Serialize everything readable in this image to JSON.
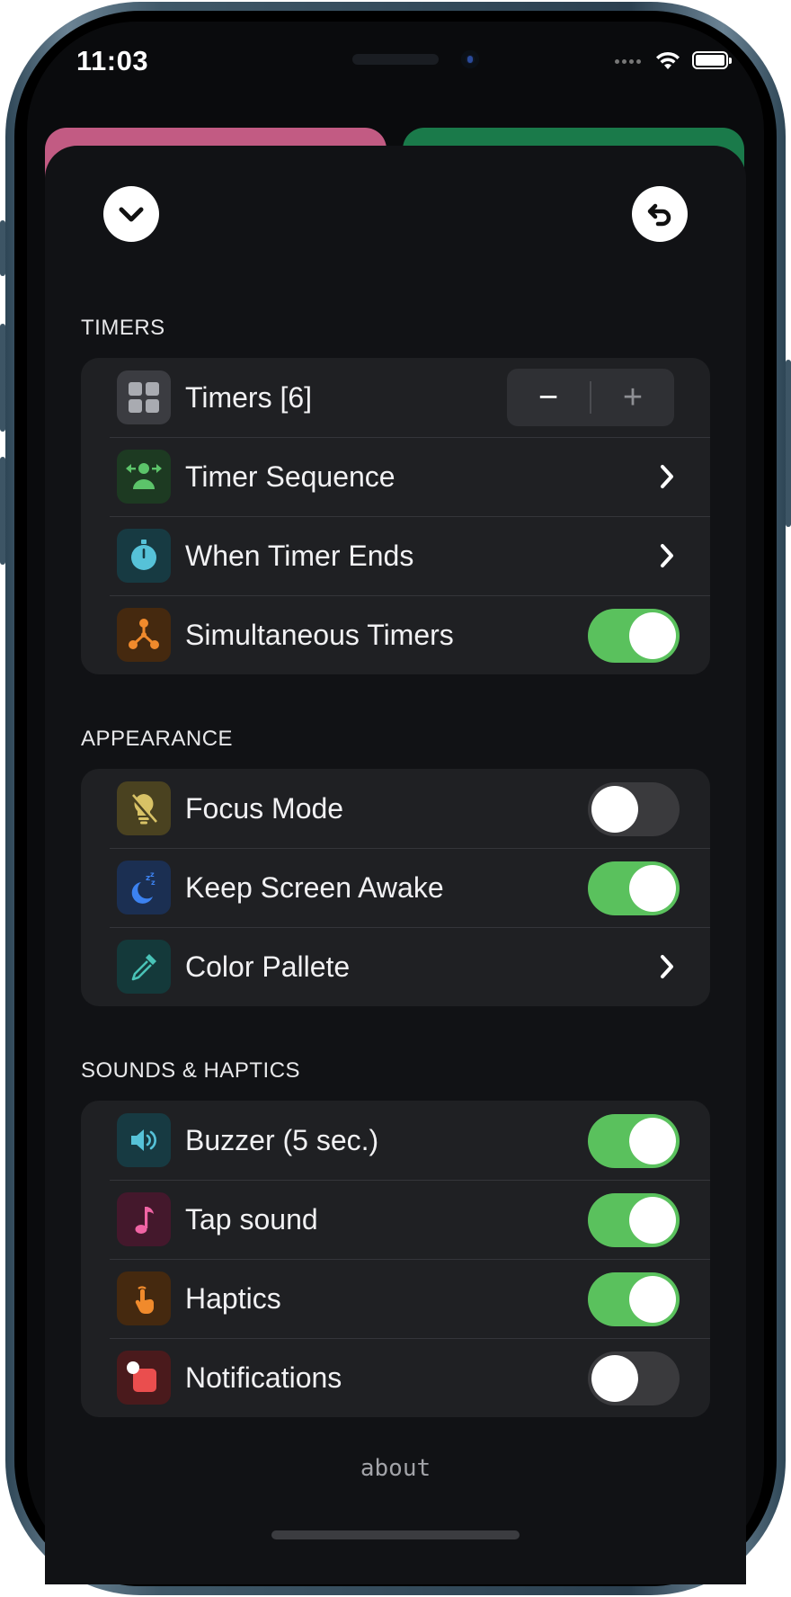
{
  "status_bar": {
    "time": "11:03"
  },
  "toolbar": {
    "collapse_icon": "chevron-down-icon",
    "reset_icon": "undo-icon"
  },
  "sections": {
    "timers": {
      "header": "TIMERS",
      "timers_count_label": "Timers [6]",
      "stepper": {
        "minus": "−",
        "plus": "+"
      },
      "timer_sequence": "Timer Sequence",
      "when_timer_ends": "When Timer Ends",
      "simultaneous_timers": "Simultaneous Timers",
      "simultaneous_timers_on": true
    },
    "appearance": {
      "header": "APPEARANCE",
      "focus_mode": "Focus Mode",
      "focus_mode_on": false,
      "keep_screen_awake": "Keep Screen Awake",
      "keep_screen_awake_on": true,
      "color_pallete": "Color Pallete"
    },
    "sounds": {
      "header": "SOUNDS & HAPTICS",
      "buzzer": "Buzzer (5 sec.)",
      "buzzer_on": true,
      "tap_sound": "Tap sound",
      "tap_sound_on": true,
      "haptics": "Haptics",
      "haptics_on": true,
      "notifications": "Notifications",
      "notifications_on": false
    }
  },
  "footer": {
    "about": "about"
  },
  "colors": {
    "toggle_on": "#5ac15d",
    "toggle_off": "#3a3a3d",
    "accent_pink": "#c25b83",
    "accent_green": "#1a7a4a"
  }
}
